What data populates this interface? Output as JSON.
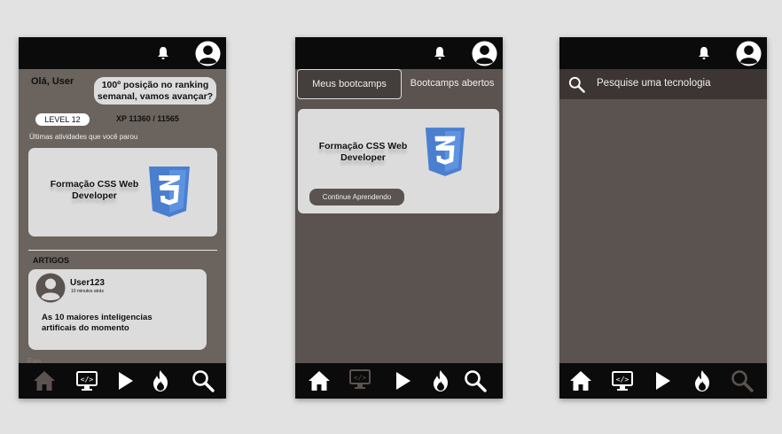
{
  "screen1": {
    "greeting": "Olá, User",
    "ranking_bubble": "100º posição no ranking semanal, vamos avançar?",
    "level": "LEVEL 12",
    "xp": "XP 11360 / 11565",
    "last_activities_label": "Últimas atividades que você parou",
    "course_card": {
      "title": "Formação CSS Web Developer"
    },
    "articles_heading": "ARTIGOS",
    "article": {
      "user": "User123",
      "time": "10 minutos atrás",
      "title": "As 10 maiores inteligencias artificais do momento"
    },
    "fading_text": "Ees"
  },
  "screen2": {
    "tabs": [
      "Meus bootcamps",
      "Bootcamps abertos"
    ],
    "course_card": {
      "title": "Formação CSS Web Developer",
      "button": "Continue Aprendendo"
    }
  },
  "screen3": {
    "search_placeholder": "Pesquise uma tecnologia"
  },
  "icons": {
    "top": [
      "bell-icon",
      "user-avatar-icon"
    ],
    "nav": [
      "home-icon",
      "code-monitor-icon",
      "play-icon",
      "fire-icon",
      "search-icon"
    ]
  },
  "colors": {
    "bar": "#0b0b0b",
    "background": "#5b5350",
    "card": "#dcdcdc",
    "css_logo": "#4a7fd0"
  }
}
